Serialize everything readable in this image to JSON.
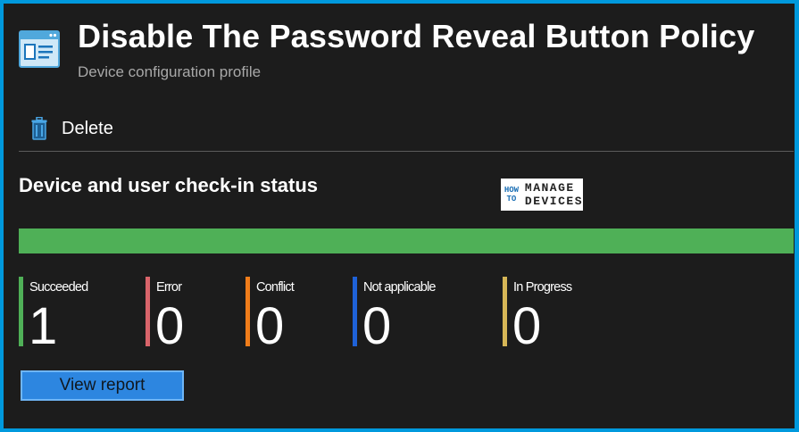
{
  "header": {
    "title": "Disable The Password Reveal Button Policy",
    "subtitle": "Device configuration profile"
  },
  "toolbar": {
    "delete_label": "Delete"
  },
  "status": {
    "section_title": "Device and user check-in status",
    "progress_fraction": 1.0,
    "stats": [
      {
        "label": "Succeeded",
        "value": "1",
        "color": "#4fb057"
      },
      {
        "label": "Error",
        "value": "0",
        "color": "#d9646a"
      },
      {
        "label": "Conflict",
        "value": "0",
        "color": "#f07d1a"
      },
      {
        "label": "Not applicable",
        "value": "0",
        "color": "#1f62d8"
      },
      {
        "label": "In Progress",
        "value": "0",
        "color": "#d6b656"
      }
    ],
    "view_report_label": "View report"
  },
  "watermark": {
    "how_to": [
      "HOW",
      "TO"
    ],
    "brand": [
      "MANAGE",
      "DEVICES"
    ]
  },
  "colors": {
    "accent": "#2d86e0",
    "success": "#4fb057",
    "background": "#1c1c1c"
  },
  "icons": {
    "page": "profile-window-icon",
    "delete": "trash-icon"
  }
}
